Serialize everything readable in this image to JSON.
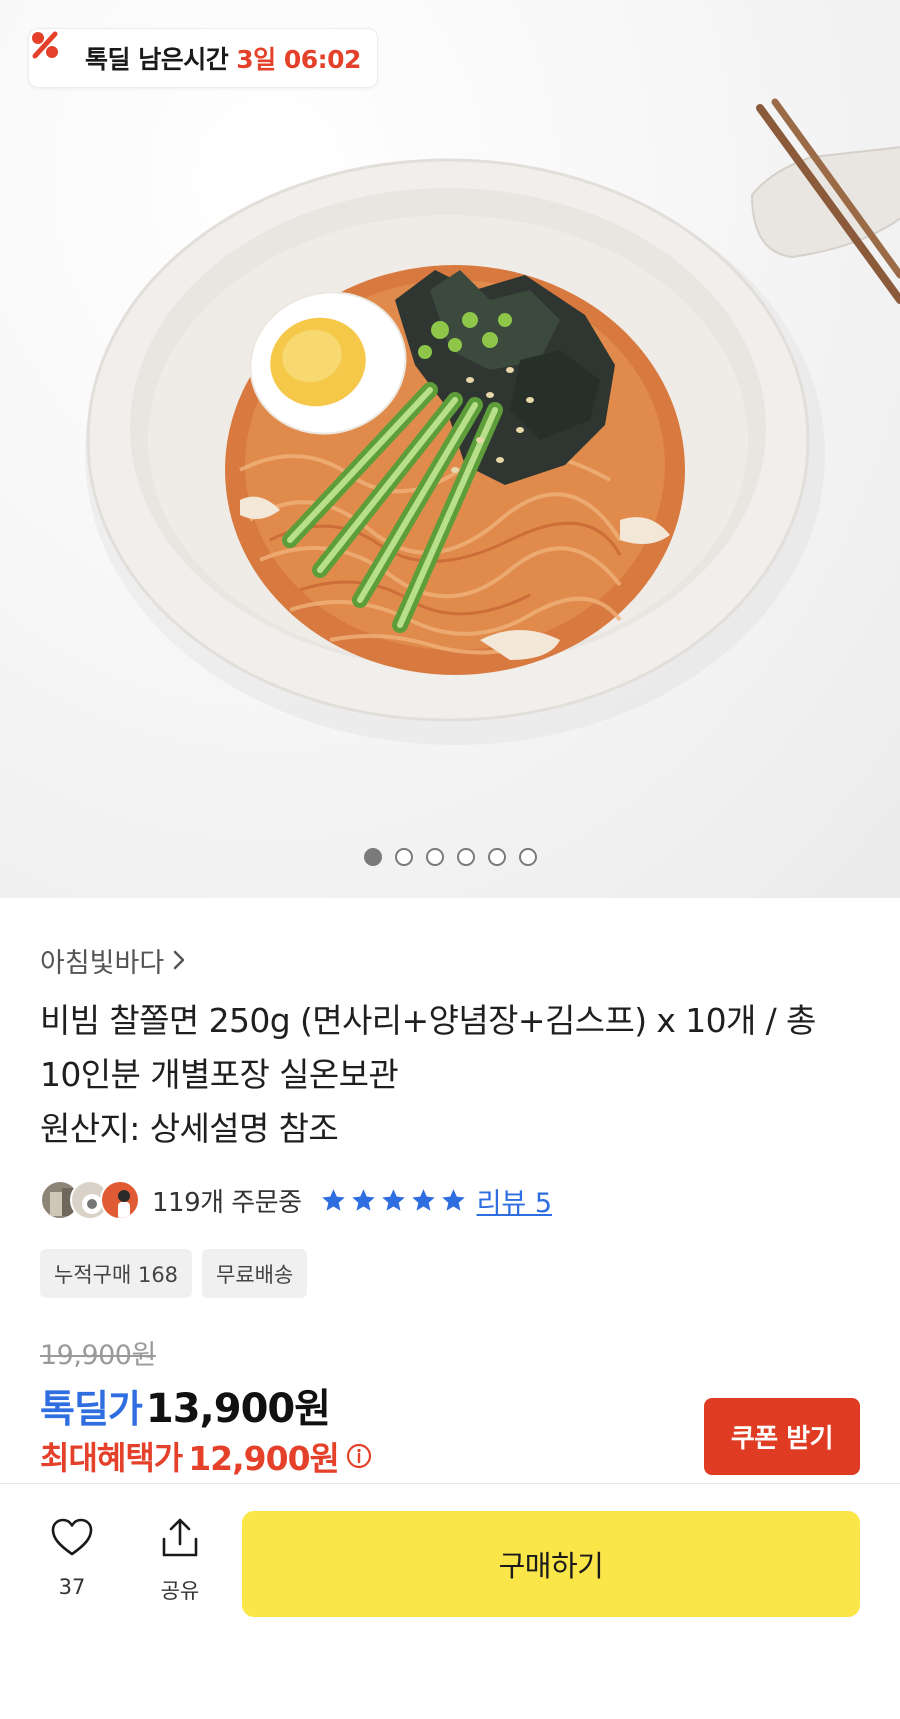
{
  "timer": {
    "label": "톡딜 남은시간",
    "value": "3일 06:02",
    "icon": "percent-icon"
  },
  "carousel": {
    "image": "bibim-noodle-bowl-photo",
    "total": 6,
    "active_index": 1
  },
  "seller": {
    "name": "아침빛바다",
    "icon": "chevron-right-icon"
  },
  "product": {
    "title_line1": "비빔 찰쫄면 250g (면사리+양념장+김스프) x 10개 / 총",
    "title_line2": "10인분 개별포장 실온보관",
    "origin": "원산지: 상세설명 참조"
  },
  "stats": {
    "orders": "119개 주문중",
    "rating_stars": 5,
    "review_link": "리뷰 5"
  },
  "tags": [
    "누적구매 168",
    "무료배송"
  ],
  "price": {
    "original": "19,900원",
    "deal_label": "톡딜가",
    "deal_price": "13,900원",
    "max_label": "최대혜택가",
    "max_price": "12,900원"
  },
  "coupon_button": "쿠폰 받기",
  "bottom_bar": {
    "like_count": "37",
    "share_label": "공유",
    "buy_label": "구매하기"
  },
  "colors": {
    "accent_red": "#e4402a",
    "accent_blue": "#2f6ee0",
    "buy_yellow": "#fbe64a"
  }
}
